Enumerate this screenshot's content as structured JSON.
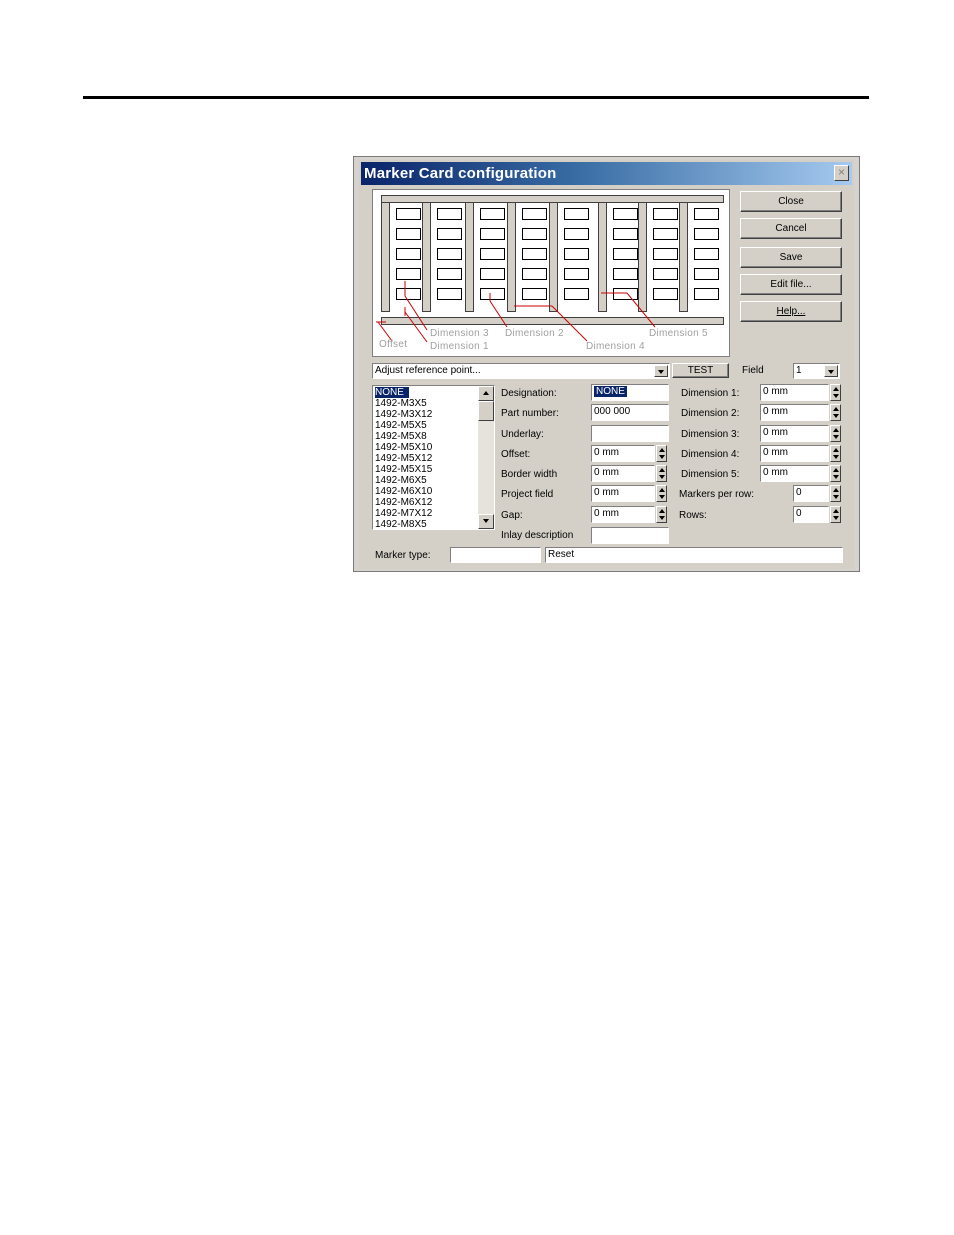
{
  "window": {
    "title": "Marker Card configuration",
    "close_glyph": "×"
  },
  "preview": {
    "labels": {
      "offset": "Offset",
      "dimension_1": "Dimension 1",
      "dimension_2": "Dimension 2",
      "dimension_3": "Dimension 3",
      "dimension_4": "Dimension 4",
      "dimension_5": "Dimension 5"
    },
    "columns": 8,
    "rows": 5,
    "annotation_color": "#cc0000"
  },
  "buttons": {
    "close": "Close",
    "cancel": "Cancel",
    "save": "Save",
    "edit_file": "Edit file...",
    "help": "Help...",
    "test": "TEST"
  },
  "reference_point": {
    "value": "Adjust reference point..."
  },
  "field": {
    "label": "Field",
    "value": "1"
  },
  "marker_list": {
    "items": [
      "NONE",
      "1492-M3X5",
      "1492-M3X12",
      "1492-M5X5",
      "1492-M5X8",
      "1492-M5X10",
      "1492-M5X12",
      "1492-M5X15",
      "1492-M6X5",
      "1492-M6X10",
      "1492-M6X12",
      "1492-M7X12",
      "1492-M8X5"
    ],
    "selected": "NONE"
  },
  "form": {
    "designation": {
      "label": "Designation:",
      "value": "NONE"
    },
    "part_number": {
      "label": "Part number:",
      "value": "000 000"
    },
    "underlay": {
      "label": "Underlay:",
      "value": ""
    },
    "offset": {
      "label": "Offset:",
      "value": "0 mm"
    },
    "border_width": {
      "label": "Border width",
      "value": "0 mm"
    },
    "project_field": {
      "label": "Project field",
      "value": "0 mm"
    },
    "gap": {
      "label": "Gap:",
      "value": "0 mm"
    },
    "inlay_description": {
      "label": "Inlay description",
      "value": ""
    },
    "dimension_1": {
      "label": "Dimension 1:",
      "value": "0 mm"
    },
    "dimension_2": {
      "label": "Dimension 2:",
      "value": "0 mm"
    },
    "dimension_3": {
      "label": "Dimension 3:",
      "value": "0 mm"
    },
    "dimension_4": {
      "label": "Dimension 4:",
      "value": "0 mm"
    },
    "dimension_5": {
      "label": "Dimension 5:",
      "value": "0 mm"
    },
    "markers_per_row": {
      "label": "Markers per row:",
      "value": "0"
    },
    "rows": {
      "label": "Rows:",
      "value": "0"
    },
    "marker_type": {
      "label": "Marker type:",
      "value": ""
    },
    "status": {
      "value": "Reset"
    }
  }
}
